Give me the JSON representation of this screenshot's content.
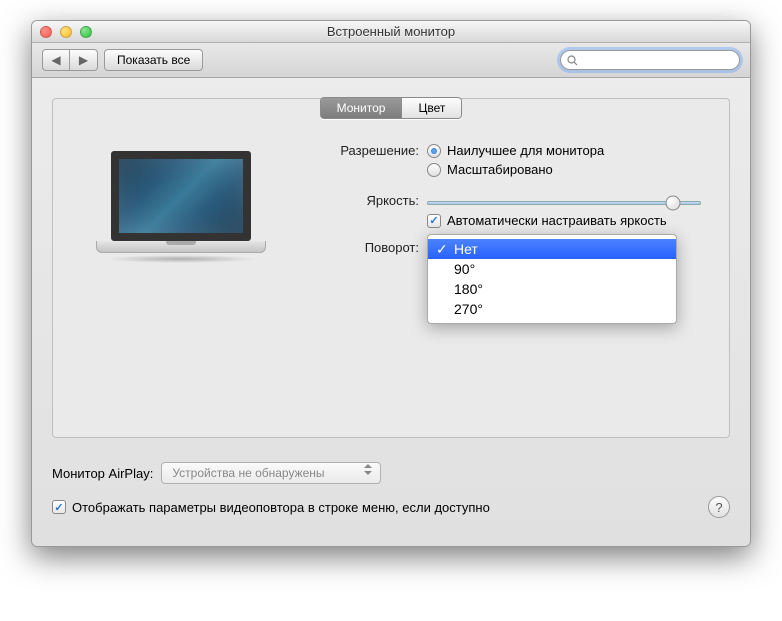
{
  "window": {
    "title": "Встроенный монитор"
  },
  "toolbar": {
    "show_all": "Показать все",
    "search_placeholder": ""
  },
  "tabs": {
    "monitor": "Монитор",
    "color": "Цвет"
  },
  "resolution": {
    "label": "Разрешение:",
    "best": "Наилучшее для монитора",
    "scaled": "Масштабировано"
  },
  "brightness": {
    "label": "Яркость:",
    "auto": "Автоматически настраивать яркость"
  },
  "rotation": {
    "label": "Поворот:",
    "options": [
      "Нет",
      "90°",
      "180°",
      "270°"
    ]
  },
  "airplay": {
    "label": "Монитор AirPlay:",
    "value": "Устройства не обнаружены"
  },
  "mirror": {
    "label": "Отображать параметры видеоповтора в строке меню, если доступно"
  },
  "help": "?"
}
